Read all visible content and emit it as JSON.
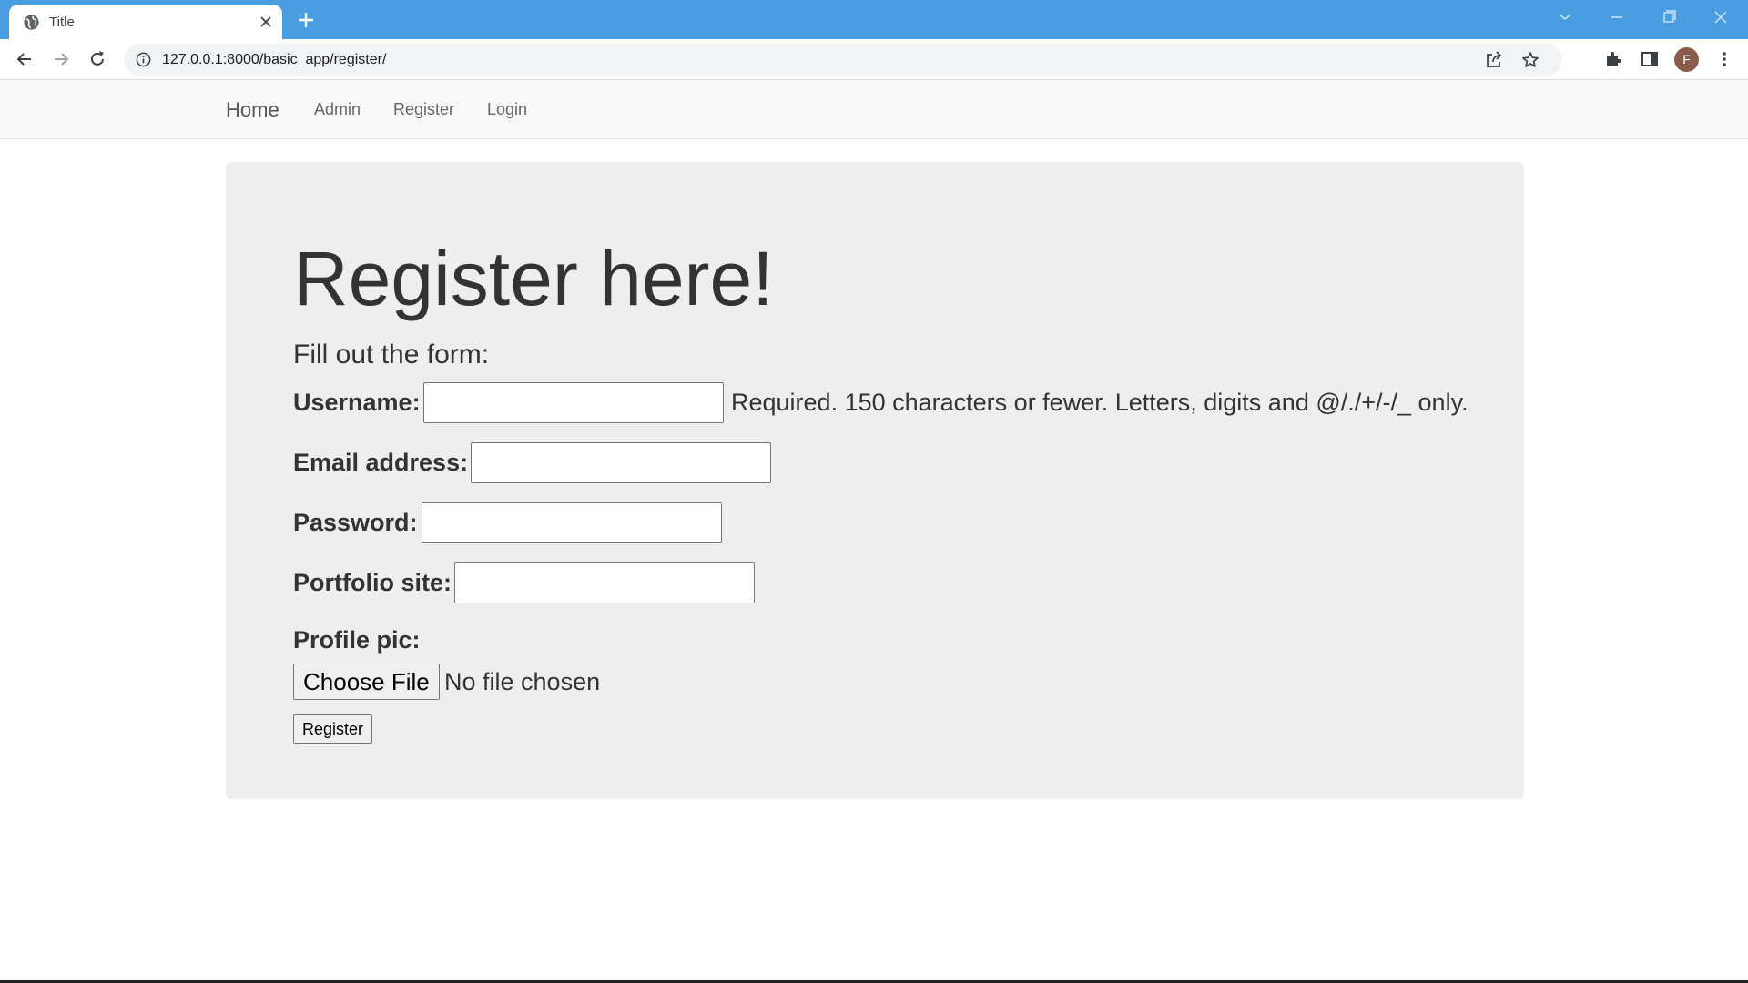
{
  "browser": {
    "tab_title": "Title",
    "url": "127.0.0.1:8000/basic_app/register/",
    "profile_initial": "F",
    "titlebar_color": "#4a9de0"
  },
  "navbar": {
    "brand": "Home",
    "links": [
      "Admin",
      "Register",
      "Login"
    ]
  },
  "form": {
    "heading": "Register here!",
    "subheading": "Fill out the form:",
    "username_label": "Username:",
    "username_value": "",
    "username_help": "Required. 150 characters or fewer. Letters, digits and @/./+/-/_ only.",
    "email_label": "Email address:",
    "email_value": "",
    "password_label": "Password:",
    "password_value": "",
    "portfolio_label": "Portfolio site:",
    "portfolio_value": "",
    "profile_pic_label": "Profile pic:",
    "choose_file_label": "Choose File",
    "file_status": "No file chosen",
    "submit_label": "Register"
  },
  "icons": {
    "favicon": "globe-icon",
    "tab_close": "close-icon",
    "new_tab": "plus-icon",
    "back": "arrow-left-icon",
    "forward": "arrow-right-icon",
    "reload": "reload-icon",
    "site_info": "info-icon",
    "share": "share-icon",
    "bookmark": "star-icon",
    "extensions": "puzzle-icon",
    "side_panel": "side-panel-icon",
    "menu": "kebab-menu-icon"
  }
}
